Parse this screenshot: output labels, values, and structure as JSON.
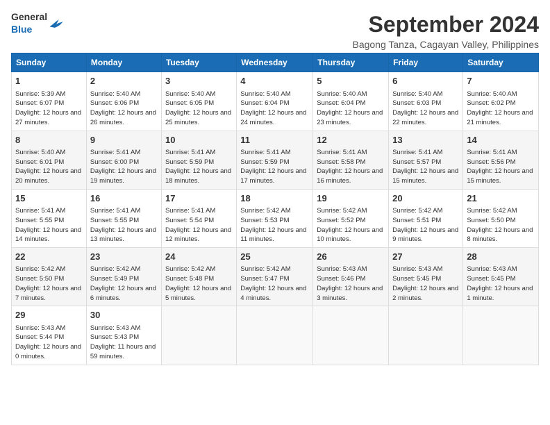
{
  "logo": {
    "general": "General",
    "blue": "Blue"
  },
  "header": {
    "month_year": "September 2024",
    "location": "Bagong Tanza, Cagayan Valley, Philippines"
  },
  "weekdays": [
    "Sunday",
    "Monday",
    "Tuesday",
    "Wednesday",
    "Thursday",
    "Friday",
    "Saturday"
  ],
  "weeks": [
    [
      {
        "day": "1",
        "sunrise": "Sunrise: 5:39 AM",
        "sunset": "Sunset: 6:07 PM",
        "daylight": "Daylight: 12 hours and 27 minutes."
      },
      {
        "day": "2",
        "sunrise": "Sunrise: 5:40 AM",
        "sunset": "Sunset: 6:06 PM",
        "daylight": "Daylight: 12 hours and 26 minutes."
      },
      {
        "day": "3",
        "sunrise": "Sunrise: 5:40 AM",
        "sunset": "Sunset: 6:05 PM",
        "daylight": "Daylight: 12 hours and 25 minutes."
      },
      {
        "day": "4",
        "sunrise": "Sunrise: 5:40 AM",
        "sunset": "Sunset: 6:04 PM",
        "daylight": "Daylight: 12 hours and 24 minutes."
      },
      {
        "day": "5",
        "sunrise": "Sunrise: 5:40 AM",
        "sunset": "Sunset: 6:04 PM",
        "daylight": "Daylight: 12 hours and 23 minutes."
      },
      {
        "day": "6",
        "sunrise": "Sunrise: 5:40 AM",
        "sunset": "Sunset: 6:03 PM",
        "daylight": "Daylight: 12 hours and 22 minutes."
      },
      {
        "day": "7",
        "sunrise": "Sunrise: 5:40 AM",
        "sunset": "Sunset: 6:02 PM",
        "daylight": "Daylight: 12 hours and 21 minutes."
      }
    ],
    [
      {
        "day": "8",
        "sunrise": "Sunrise: 5:40 AM",
        "sunset": "Sunset: 6:01 PM",
        "daylight": "Daylight: 12 hours and 20 minutes."
      },
      {
        "day": "9",
        "sunrise": "Sunrise: 5:41 AM",
        "sunset": "Sunset: 6:00 PM",
        "daylight": "Daylight: 12 hours and 19 minutes."
      },
      {
        "day": "10",
        "sunrise": "Sunrise: 5:41 AM",
        "sunset": "Sunset: 5:59 PM",
        "daylight": "Daylight: 12 hours and 18 minutes."
      },
      {
        "day": "11",
        "sunrise": "Sunrise: 5:41 AM",
        "sunset": "Sunset: 5:59 PM",
        "daylight": "Daylight: 12 hours and 17 minutes."
      },
      {
        "day": "12",
        "sunrise": "Sunrise: 5:41 AM",
        "sunset": "Sunset: 5:58 PM",
        "daylight": "Daylight: 12 hours and 16 minutes."
      },
      {
        "day": "13",
        "sunrise": "Sunrise: 5:41 AM",
        "sunset": "Sunset: 5:57 PM",
        "daylight": "Daylight: 12 hours and 15 minutes."
      },
      {
        "day": "14",
        "sunrise": "Sunrise: 5:41 AM",
        "sunset": "Sunset: 5:56 PM",
        "daylight": "Daylight: 12 hours and 15 minutes."
      }
    ],
    [
      {
        "day": "15",
        "sunrise": "Sunrise: 5:41 AM",
        "sunset": "Sunset: 5:55 PM",
        "daylight": "Daylight: 12 hours and 14 minutes."
      },
      {
        "day": "16",
        "sunrise": "Sunrise: 5:41 AM",
        "sunset": "Sunset: 5:55 PM",
        "daylight": "Daylight: 12 hours and 13 minutes."
      },
      {
        "day": "17",
        "sunrise": "Sunrise: 5:41 AM",
        "sunset": "Sunset: 5:54 PM",
        "daylight": "Daylight: 12 hours and 12 minutes."
      },
      {
        "day": "18",
        "sunrise": "Sunrise: 5:42 AM",
        "sunset": "Sunset: 5:53 PM",
        "daylight": "Daylight: 12 hours and 11 minutes."
      },
      {
        "day": "19",
        "sunrise": "Sunrise: 5:42 AM",
        "sunset": "Sunset: 5:52 PM",
        "daylight": "Daylight: 12 hours and 10 minutes."
      },
      {
        "day": "20",
        "sunrise": "Sunrise: 5:42 AM",
        "sunset": "Sunset: 5:51 PM",
        "daylight": "Daylight: 12 hours and 9 minutes."
      },
      {
        "day": "21",
        "sunrise": "Sunrise: 5:42 AM",
        "sunset": "Sunset: 5:50 PM",
        "daylight": "Daylight: 12 hours and 8 minutes."
      }
    ],
    [
      {
        "day": "22",
        "sunrise": "Sunrise: 5:42 AM",
        "sunset": "Sunset: 5:50 PM",
        "daylight": "Daylight: 12 hours and 7 minutes."
      },
      {
        "day": "23",
        "sunrise": "Sunrise: 5:42 AM",
        "sunset": "Sunset: 5:49 PM",
        "daylight": "Daylight: 12 hours and 6 minutes."
      },
      {
        "day": "24",
        "sunrise": "Sunrise: 5:42 AM",
        "sunset": "Sunset: 5:48 PM",
        "daylight": "Daylight: 12 hours and 5 minutes."
      },
      {
        "day": "25",
        "sunrise": "Sunrise: 5:42 AM",
        "sunset": "Sunset: 5:47 PM",
        "daylight": "Daylight: 12 hours and 4 minutes."
      },
      {
        "day": "26",
        "sunrise": "Sunrise: 5:43 AM",
        "sunset": "Sunset: 5:46 PM",
        "daylight": "Daylight: 12 hours and 3 minutes."
      },
      {
        "day": "27",
        "sunrise": "Sunrise: 5:43 AM",
        "sunset": "Sunset: 5:45 PM",
        "daylight": "Daylight: 12 hours and 2 minutes."
      },
      {
        "day": "28",
        "sunrise": "Sunrise: 5:43 AM",
        "sunset": "Sunset: 5:45 PM",
        "daylight": "Daylight: 12 hours and 1 minute."
      }
    ],
    [
      {
        "day": "29",
        "sunrise": "Sunrise: 5:43 AM",
        "sunset": "Sunset: 5:44 PM",
        "daylight": "Daylight: 12 hours and 0 minutes."
      },
      {
        "day": "30",
        "sunrise": "Sunrise: 5:43 AM",
        "sunset": "Sunset: 5:43 PM",
        "daylight": "Daylight: 11 hours and 59 minutes."
      },
      null,
      null,
      null,
      null,
      null
    ]
  ]
}
